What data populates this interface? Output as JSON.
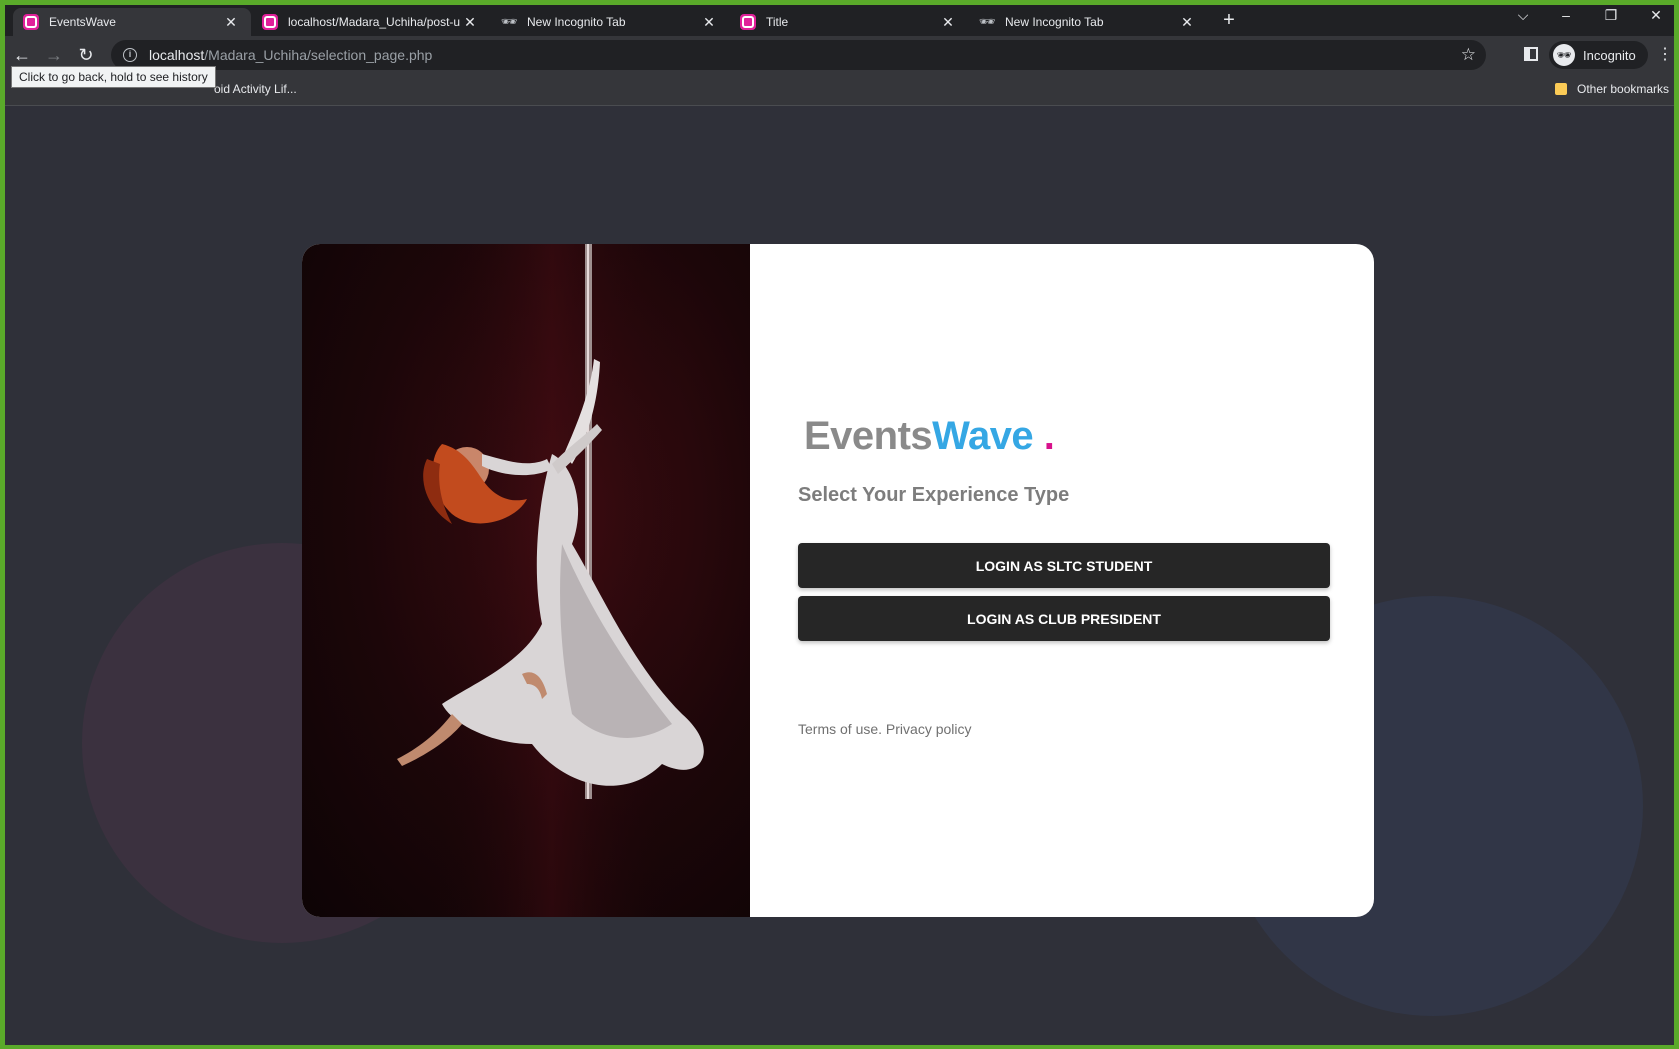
{
  "browser": {
    "tabs": [
      {
        "title": "EventsWave",
        "favicon": "eventswave-icon",
        "active": true
      },
      {
        "title": "localhost/Madara_Uchiha/post-u",
        "favicon": "eventswave-icon",
        "active": false
      },
      {
        "title": "New Incognito Tab",
        "favicon": "incognito-icon",
        "active": false
      },
      {
        "title": "Title",
        "favicon": "eventswave-icon",
        "active": false
      },
      {
        "title": "New Incognito Tab",
        "favicon": "incognito-icon",
        "active": false
      }
    ],
    "url_host": "localhost",
    "url_path": "/Madara_Uchiha/selection_page.php",
    "profile_label": "Incognito",
    "tooltip": "Click to go back, hold to see history",
    "bookmark_partial": "oid Activity Lif...",
    "other_bookmarks": "Other bookmarks"
  },
  "page": {
    "logo_part1": "Events",
    "logo_part2": "Wave",
    "logo_dot": " .",
    "subtitle": "Select Your Experience Type",
    "buttons": {
      "student": "LOGIN AS SLTC STUDENT",
      "president": "LOGIN AS CLUB PRESIDENT"
    },
    "footer": "Terms of use. Privacy policy"
  },
  "colors": {
    "brand_gray": "#8a8a8a",
    "brand_blue": "#35a7e4",
    "brand_magenta": "#d8118c",
    "button_bg": "#262626",
    "page_bg": "#2f3039"
  }
}
